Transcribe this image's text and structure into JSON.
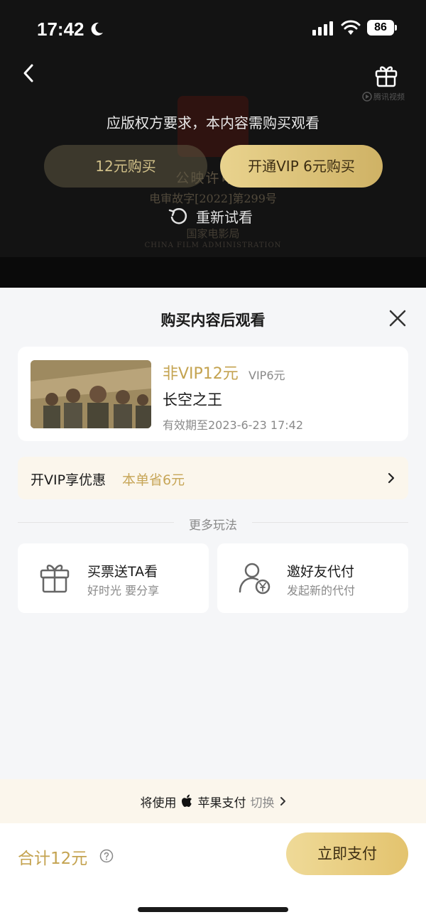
{
  "status": {
    "time": "17:42",
    "battery": "86"
  },
  "player": {
    "notice": "应版权方要求，本内容需购买观看",
    "buy_button": "12元购买",
    "vip_button": "开通VIP  6元购买",
    "retry": "重新试看",
    "brand": "腾讯视频",
    "cert_line1": "公映许可证",
    "cert_line2": "电审故字[2022]第299号",
    "cert_line3": "国家电影局",
    "cert_line4": "CHINA FILM ADMINISTRATION"
  },
  "sheet": {
    "title": "购买内容后观看",
    "item": {
      "price": "非VIP12元",
      "vip_price": "VIP6元",
      "name": "长空之王",
      "valid": "有效期至2023-6-23 17:42"
    },
    "vip_offer": {
      "label": "开VIP享优惠",
      "saving": "本单省6元"
    },
    "more_label": "更多玩法",
    "options": [
      {
        "title": "买票送TA看",
        "subtitle": "好时光 要分享",
        "icon": "gift-icon"
      },
      {
        "title": "邀好友代付",
        "subtitle": "发起新的代付",
        "icon": "user-yen-icon"
      }
    ],
    "payment": {
      "prefix": "将使用",
      "method": "苹果支付",
      "switch": "切换"
    },
    "footer": {
      "total": "合计12元",
      "pay_button": "立即支付"
    }
  },
  "colors": {
    "gold": "#c4a350",
    "gold_button": "#e3c36e",
    "cream": "#fbf6ec",
    "background": "#f5f6f8"
  }
}
